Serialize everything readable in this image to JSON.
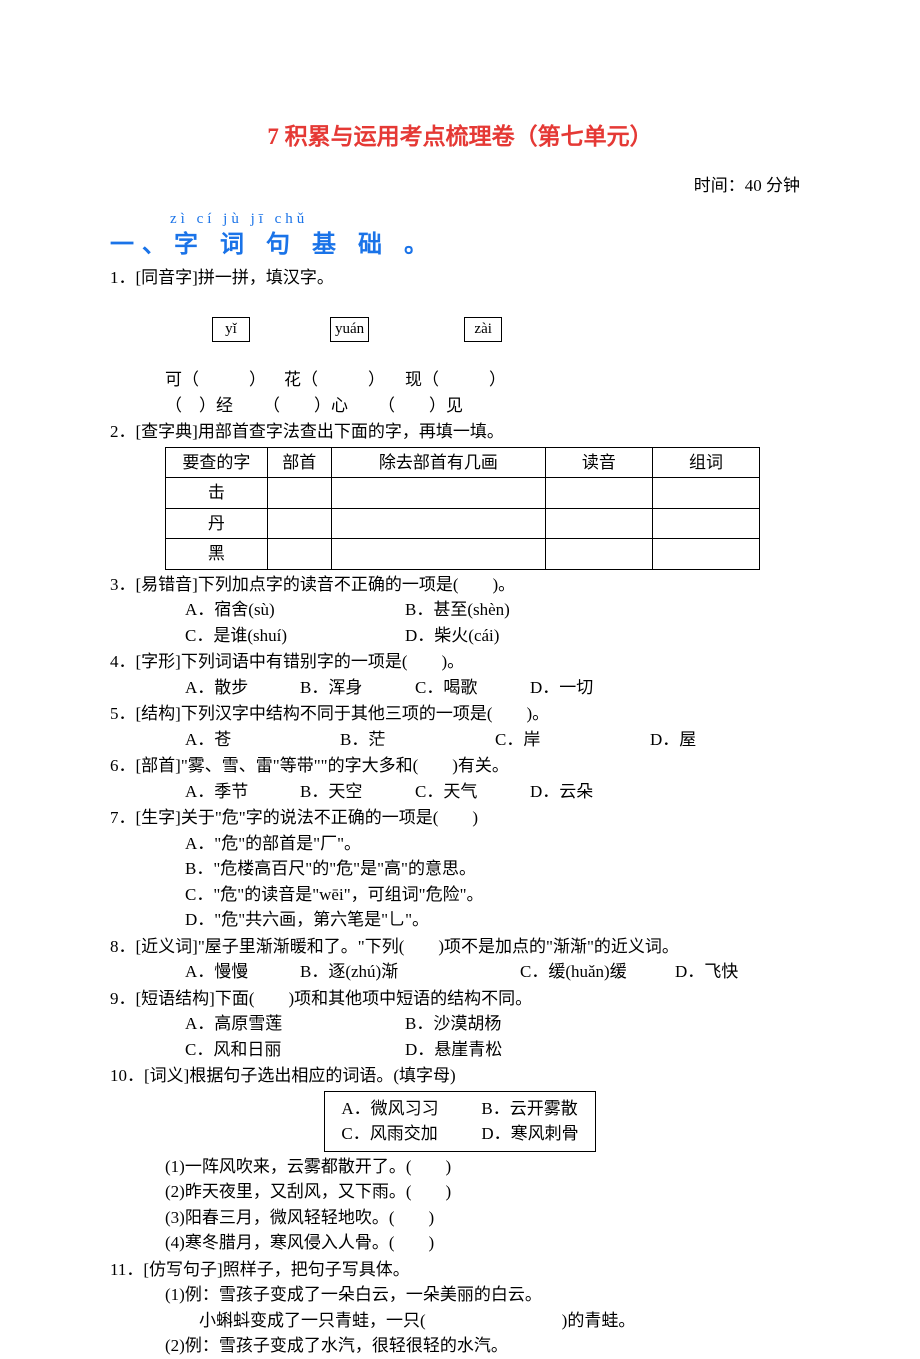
{
  "title": "7 积累与运用考点梳理卷（第七单元）",
  "time": "时间：40 分钟",
  "section1_pinyin": "zì cí jù jī chǔ",
  "section1": "一、字 词 句 基 础 。",
  "q1": {
    "stem": "1．[同音字]拼一拼，填汉字。",
    "p1": "yǐ",
    "p2": "yuán",
    "p3": "zài",
    "r1a": "可（",
    "r1b": "）",
    "r1c": "花（",
    "r1d": "）",
    "r1e": "现（",
    "r1f": "）",
    "r2a": "（　）经",
    "r2b": "（　　）心",
    "r2c": "（　　）见"
  },
  "q2": {
    "stem": "2．[查字典]用部首查字法查出下面的字，再填一填。",
    "headers": [
      "要查的字",
      "部首",
      "除去部首有几画",
      "读音",
      "组词"
    ],
    "rows": [
      "击",
      "丹",
      "黑"
    ]
  },
  "q3": {
    "stem": "3．[易错音]下列加点字的读音不正确的一项是(　　)。",
    "a": "A．宿舍(sù)",
    "b": "B．甚至(shèn)",
    "c": "C．是谁(shuí)",
    "d": "D．柴火(cái)"
  },
  "q4": {
    "stem": "4．[字形]下列词语中有错别字的一项是(　　)。",
    "a": "A．散步",
    "b": "B．浑身",
    "c": "C．喝歌",
    "d": "D．一切"
  },
  "q5": {
    "stem": "5．[结构]下列汉字中结构不同于其他三项的一项是(　　)。",
    "a": "A．苍",
    "b": "B．茫",
    "c": "C．岸",
    "d": "D．屋"
  },
  "q6": {
    "stem": "6．[部首]\"雾、雪、雷\"等带\"\"的字大多和(　　)有关。",
    "a": "A．季节",
    "b": "B．天空",
    "c": "C．天气",
    "d": "D．云朵"
  },
  "q7": {
    "stem": "7．[生字]关于\"危\"字的说法不正确的一项是(　　)",
    "a": "A．\"危\"的部首是\"厂\"。",
    "b": "B．\"危楼高百尺\"的\"危\"是\"高\"的意思。",
    "c": "C．\"危\"的读音是\"wēi\"，可组词\"危险\"。",
    "d": "D．\"危\"共六画，第六笔是\"乚\"。"
  },
  "q8": {
    "stem": "8．[近义词]\"屋子里渐渐暖和了。\"下列(　　)项不是加点的\"渐渐\"的近义词。",
    "a": "A．慢慢",
    "b": "B．逐(zhú)渐",
    "c": "C．缓(huǎn)缓",
    "d": "D．飞快"
  },
  "q9": {
    "stem": "9．[短语结构]下面(　　)项和其他项中短语的结构不同。",
    "a": "A．高原雪莲",
    "b": "B．沙漠胡杨",
    "c": "C．风和日丽",
    "d": "D．悬崖青松"
  },
  "q10": {
    "stem": "10．[词义]根据句子选出相应的词语。(填字母)",
    "box_r1a": "A．微风习习",
    "box_r1b": "B．云开雾散",
    "box_r2a": "C．风雨交加",
    "box_r2b": "D．寒风刺骨",
    "s1": "(1)一阵风吹来，云雾都散开了。(　　)",
    "s2": "(2)昨天夜里，又刮风，又下雨。(　　)",
    "s3": "(3)阳春三月，微风轻轻地吹。(　　)",
    "s4": "(4)寒冬腊月，寒风侵入人骨。(　　)"
  },
  "q11": {
    "stem": "11．[仿写句子]照样子，把句子写具体。",
    "s1a": "(1)例：雪孩子变成了一朵白云，一朵美丽的白云。",
    "s1b": "小蝌蚪变成了一只青蛙，一只(　　　　　　　　)的青蛙。",
    "s2": "(2)例：雪孩子变成了水汽，很轻很轻的水汽。"
  }
}
